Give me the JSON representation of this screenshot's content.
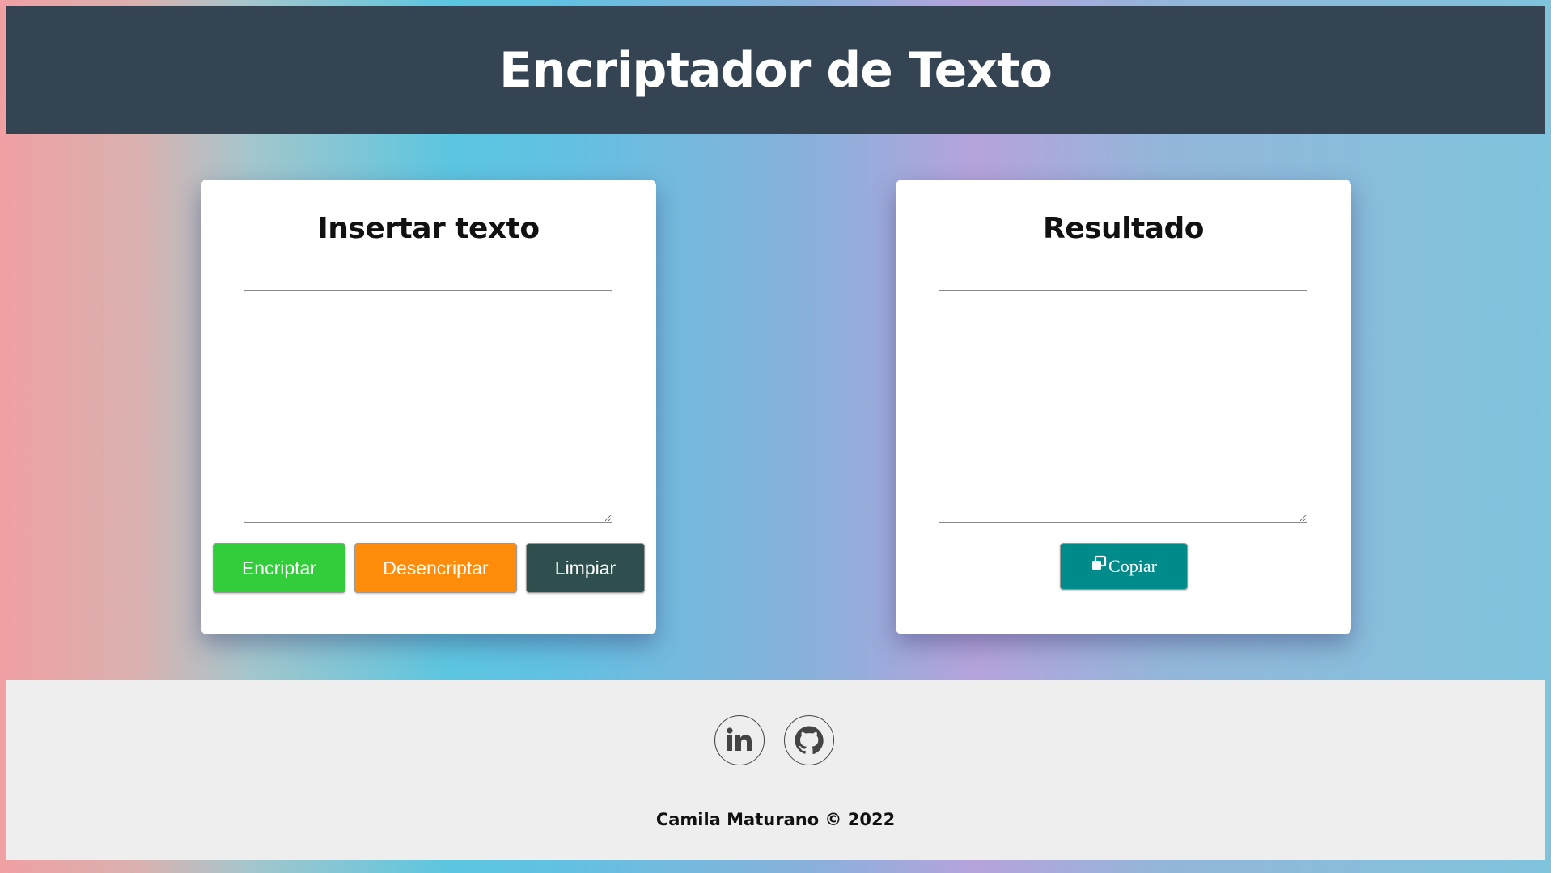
{
  "header": {
    "title": "Encriptador de Texto"
  },
  "input_card": {
    "title": "Insertar texto",
    "textarea_value": "",
    "buttons": {
      "encrypt": "Encriptar",
      "decrypt": "Desencriptar",
      "clear": "Limpiar"
    }
  },
  "result_card": {
    "title": "Resultado",
    "textarea_value": "",
    "copy_label": "Copiar",
    "copy_icon": "copy-icon"
  },
  "footer": {
    "social": [
      {
        "name": "linkedin-icon"
      },
      {
        "name": "github-icon"
      }
    ],
    "credit": "Camila Maturano © 2022"
  },
  "colors": {
    "header_bg": "#354453",
    "encrypt": "#33cc3a",
    "decrypt": "#ff8c0a",
    "clear": "#2f4f4f",
    "copy": "#008b8b",
    "footer_bg": "#eeeeee"
  }
}
